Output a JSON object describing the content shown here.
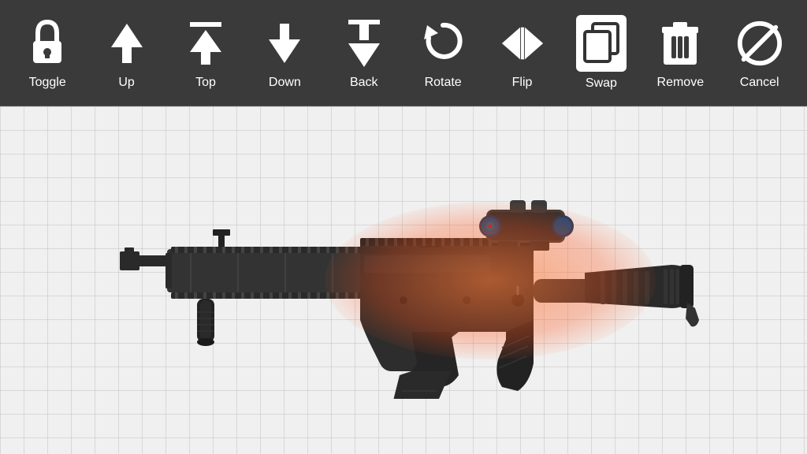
{
  "toolbar": {
    "items": [
      {
        "id": "toggle",
        "label": "Toggle",
        "icon": "lock"
      },
      {
        "id": "up",
        "label": "Up",
        "icon": "arrow-up"
      },
      {
        "id": "top",
        "label": "Top",
        "icon": "arrow-top"
      },
      {
        "id": "down",
        "label": "Down",
        "icon": "arrow-down"
      },
      {
        "id": "back",
        "label": "Back",
        "icon": "arrow-back"
      },
      {
        "id": "rotate",
        "label": "Rotate",
        "icon": "rotate"
      },
      {
        "id": "flip",
        "label": "Flip",
        "icon": "flip"
      },
      {
        "id": "swap",
        "label": "Swap",
        "icon": "swap"
      },
      {
        "id": "remove",
        "label": "Remove",
        "icon": "remove"
      },
      {
        "id": "cancel",
        "label": "Cancel",
        "icon": "cancel"
      }
    ]
  },
  "canvas": {
    "background": "#f0f0f0"
  }
}
